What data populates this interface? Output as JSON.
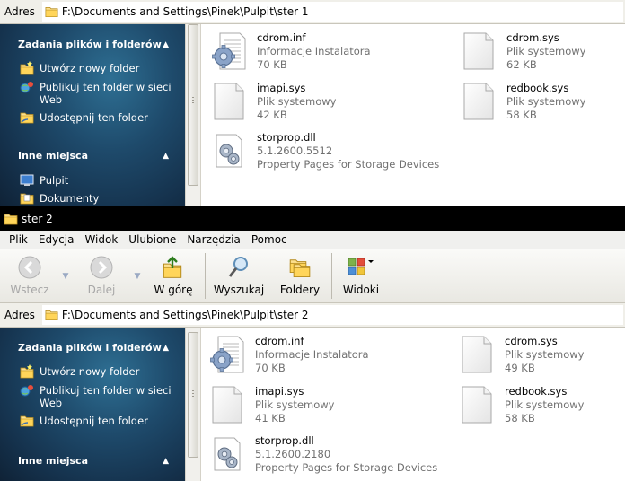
{
  "window1": {
    "address": {
      "label": "Adres",
      "path": "F:\\Documents and Settings\\Pinek\\Pulpit\\ster 1"
    },
    "taskpane": {
      "section1_title": "Zadania plików i folderów",
      "items": [
        {
          "label": "Utwórz nowy folder",
          "icon": "new-folder-icon"
        },
        {
          "label": "Publikuj ten folder w sieci Web",
          "icon": "publish-web-icon"
        },
        {
          "label": "Udostępnij ten folder",
          "icon": "share-folder-icon"
        }
      ],
      "section2_title": "Inne miejsca",
      "places": [
        {
          "label": "Pulpit",
          "icon": "desktop-icon"
        },
        {
          "label": "Dokumenty",
          "icon": "documents-icon"
        }
      ]
    },
    "files": [
      {
        "name": "cdrom.inf",
        "line2": "Informacje Instalatora",
        "line3": "70 KB",
        "icon": "inf-file-icon"
      },
      {
        "name": "cdrom.sys",
        "line2": "Plik systemowy",
        "line3": "62 KB",
        "icon": "sys-file-icon"
      },
      {
        "name": "imapi.sys",
        "line2": "Plik systemowy",
        "line3": "42 KB",
        "icon": "sys-file-icon"
      },
      {
        "name": "redbook.sys",
        "line2": "Plik systemowy",
        "line3": "58 KB",
        "icon": "sys-file-icon"
      },
      {
        "name": "storprop.dll",
        "line2": "5.1.2600.5512",
        "line3": "Property Pages for Storage Devices",
        "icon": "dll-file-icon"
      }
    ]
  },
  "window2": {
    "title": "ster 2",
    "menu": [
      "Plik",
      "Edycja",
      "Widok",
      "Ulubione",
      "Narzędzia",
      "Pomoc"
    ],
    "toolbar": {
      "back": "Wstecz",
      "forward": "Dalej",
      "up": "W górę",
      "search": "Wyszukaj",
      "folders": "Foldery",
      "views": "Widoki"
    },
    "address": {
      "label": "Adres",
      "path": "F:\\Documents and Settings\\Pinek\\Pulpit\\ster 2"
    },
    "taskpane": {
      "section1_title": "Zadania plików i folderów",
      "items": [
        {
          "label": "Utwórz nowy folder",
          "icon": "new-folder-icon"
        },
        {
          "label": "Publikuj ten folder w sieci Web",
          "icon": "publish-web-icon"
        },
        {
          "label": "Udostępnij ten folder",
          "icon": "share-folder-icon"
        }
      ],
      "section2_title": "Inne miejsca"
    },
    "files": [
      {
        "name": "cdrom.inf",
        "line2": "Informacje Instalatora",
        "line3": "70 KB",
        "icon": "inf-file-icon"
      },
      {
        "name": "cdrom.sys",
        "line2": "Plik systemowy",
        "line3": "49 KB",
        "icon": "sys-file-icon"
      },
      {
        "name": "imapi.sys",
        "line2": "Plik systemowy",
        "line3": "41 KB",
        "icon": "sys-file-icon"
      },
      {
        "name": "redbook.sys",
        "line2": "Plik systemowy",
        "line3": "58 KB",
        "icon": "sys-file-icon"
      },
      {
        "name": "storprop.dll",
        "line2": "5.1.2600.2180",
        "line3": "Property Pages for Storage Devices",
        "icon": "dll-file-icon"
      }
    ]
  }
}
